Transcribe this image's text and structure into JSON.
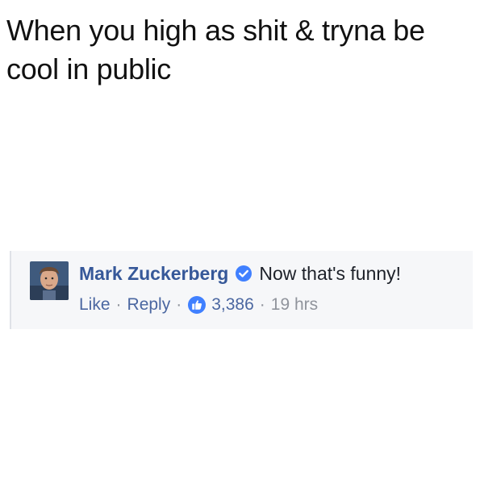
{
  "caption": "When you high as shit & tryna be cool in public",
  "comment": {
    "author": "Mark Zuckerberg",
    "verified_icon": "verified-check-icon",
    "text": "Now that's funny!",
    "actions": {
      "like_label": "Like",
      "separator": "·",
      "reply_label": "Reply",
      "like_icon": "thumbs-up-icon",
      "like_count": "3,386",
      "timestamp": "19 hrs"
    }
  },
  "colors": {
    "author_blue": "#365899",
    "link_blue": "#4b67a1",
    "badge_blue": "#4080ff",
    "muted_gray": "#90949c",
    "card_background": "#f6f7f9"
  }
}
